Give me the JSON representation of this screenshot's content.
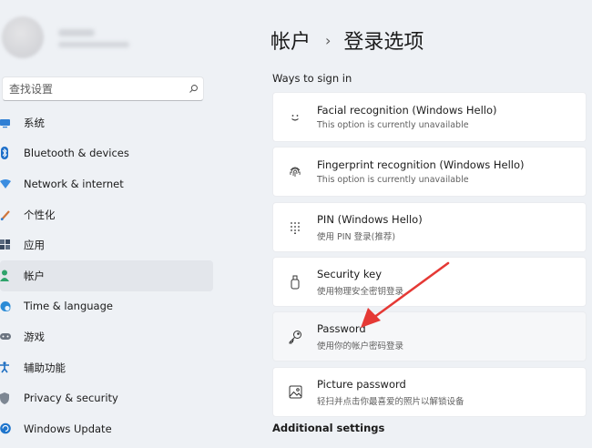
{
  "search": {
    "placeholder": "查找设置"
  },
  "nav": {
    "items": [
      {
        "label": "系统",
        "icon": "monitor-icon"
      },
      {
        "label": "Bluetooth & devices",
        "icon": "bluetooth-icon"
      },
      {
        "label": "Network & internet",
        "icon": "wifi-icon"
      },
      {
        "label": "个性化",
        "icon": "brush-icon"
      },
      {
        "label": "应用",
        "icon": "apps-icon"
      },
      {
        "label": "帐户",
        "icon": "person-icon",
        "active": true
      },
      {
        "label": "Time & language",
        "icon": "globe-clock-icon"
      },
      {
        "label": "游戏",
        "icon": "gamepad-icon"
      },
      {
        "label": "辅助功能",
        "icon": "accessibility-icon"
      },
      {
        "label": "Privacy & security",
        "icon": "shield-icon"
      },
      {
        "label": "Windows Update",
        "icon": "update-icon"
      }
    ]
  },
  "header": {
    "crumb_parent": "帐户",
    "separator": "›",
    "crumb_current": "登录选项"
  },
  "sections": {
    "ways_to_sign_in": "Ways to sign in",
    "additional_settings": "Additional settings"
  },
  "sign_in_options": [
    {
      "title": "Facial recognition (Windows Hello)",
      "subtitle": "This option is currently unavailable",
      "icon": "smiley-face-icon"
    },
    {
      "title": "Fingerprint recognition (Windows Hello)",
      "subtitle": "This option is currently unavailable",
      "icon": "fingerprint-icon"
    },
    {
      "title": "PIN (Windows Hello)",
      "subtitle": "使用 PIN 登录(推荐)",
      "icon": "pin-keypad-icon"
    },
    {
      "title": "Security key",
      "subtitle": "使用物理安全密钥登录",
      "icon": "usb-key-icon"
    },
    {
      "title": "Password",
      "subtitle": "使用你的帐户密码登录",
      "icon": "key-icon"
    },
    {
      "title": "Picture password",
      "subtitle": "轻扫并点击你最喜爱的照片以解锁设备",
      "icon": "picture-icon"
    }
  ],
  "colors": {
    "background": "#eef1f5",
    "card": "#ffffff",
    "accent": "#0067c0",
    "annotation_arrow": "#e53935"
  }
}
